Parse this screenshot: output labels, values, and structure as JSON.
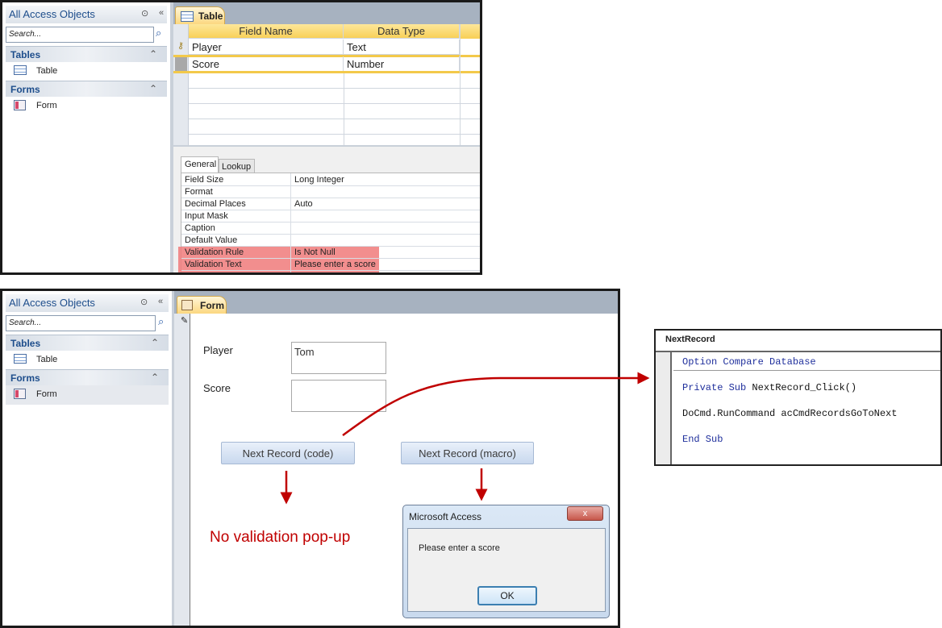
{
  "nav": {
    "title": "All Access Objects",
    "search_placeholder": "Search...",
    "groups": [
      {
        "label": "Tables",
        "items": [
          {
            "label": "Table"
          }
        ]
      },
      {
        "label": "Forms",
        "items": [
          {
            "label": "Form"
          }
        ]
      }
    ]
  },
  "table_design": {
    "tab_label": "Table",
    "columns": [
      "Field Name",
      "Data Type"
    ],
    "rows": [
      {
        "field": "Player",
        "type": "Text",
        "primary_key": true
      },
      {
        "field": "Score",
        "type": "Number",
        "primary_key": false
      }
    ],
    "property_tabs": [
      "General",
      "Lookup"
    ],
    "properties": [
      {
        "name": "Field Size",
        "value": "Long Integer"
      },
      {
        "name": "Format",
        "value": ""
      },
      {
        "name": "Decimal Places",
        "value": "Auto"
      },
      {
        "name": "Input Mask",
        "value": ""
      },
      {
        "name": "Caption",
        "value": ""
      },
      {
        "name": "Default Value",
        "value": ""
      },
      {
        "name": "Validation Rule",
        "value": "Is Not Null"
      },
      {
        "name": "Validation Text",
        "value": "Please enter a score"
      }
    ],
    "highlight_color": "#f07a7a"
  },
  "form": {
    "tab_label": "Form",
    "player_label": "Player",
    "player_value": "Tom",
    "score_label": "Score",
    "score_value": "",
    "btn_code": "Next Record (code)",
    "btn_macro": "Next Record (macro)",
    "annotation": "No validation pop-up",
    "annotation_color": "#c00000"
  },
  "dialog": {
    "title": "Microsoft Access",
    "close": "x",
    "message": "Please enter a score",
    "ok": "OK"
  },
  "code_window": {
    "title": "NextRecord",
    "lines": [
      {
        "kw": "Option Compare Database",
        "rest": ""
      },
      {
        "kw": "Private Sub",
        "rest": " NextRecord_Click()"
      },
      {
        "kw": "",
        "rest": "DoCmd.RunCommand acCmdRecordsGoToNext"
      },
      {
        "kw": "End Sub",
        "rest": ""
      }
    ]
  }
}
